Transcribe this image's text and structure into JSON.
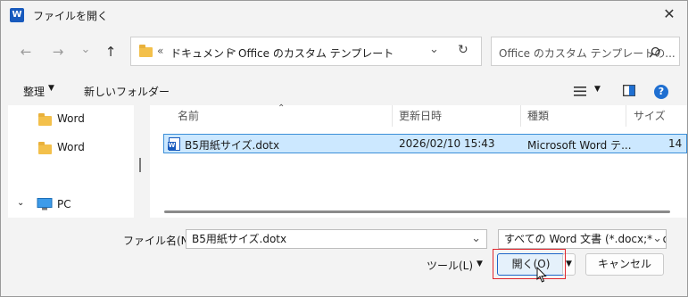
{
  "window": {
    "title": "ファイルを開く",
    "close": "✕"
  },
  "nav": {
    "back": "←",
    "forward": "→",
    "recent": "⌄",
    "up": "↑"
  },
  "address": {
    "chevrons": "«",
    "crumbs": [
      "ドキュメント",
      "Office のカスタム テンプレート"
    ],
    "separator": ">",
    "dropdown": "⌄",
    "refresh": "↻"
  },
  "search": {
    "placeholder": "Office のカスタム テンプレートの..."
  },
  "toolbar": {
    "organize": "整理",
    "new_folder": "新しいフォルダー"
  },
  "sidebar": {
    "items": [
      {
        "label": "Word"
      },
      {
        "label": "Word"
      },
      {
        "label": "PC"
      }
    ]
  },
  "columns": {
    "name": "名前",
    "modified": "更新日時",
    "type": "種類",
    "size": "サイズ"
  },
  "files": [
    {
      "name": "B5用紙サイズ.dotx",
      "modified": "2026/02/10 15:43",
      "type": "Microsoft Word テ...",
      "size": "14"
    }
  ],
  "filename": {
    "label": "ファイル名(N):",
    "value": "B5用紙サイズ.dotx"
  },
  "filetype": {
    "value": "すべての Word 文書 (*.docx;*.do"
  },
  "buttons": {
    "tools": "ツール(L)",
    "open": "開く(O)",
    "cancel": "キャンセル"
  },
  "colors": {
    "accent": "#1e66c9",
    "selection": "#cce8ff",
    "highlight": "#e0262e"
  }
}
